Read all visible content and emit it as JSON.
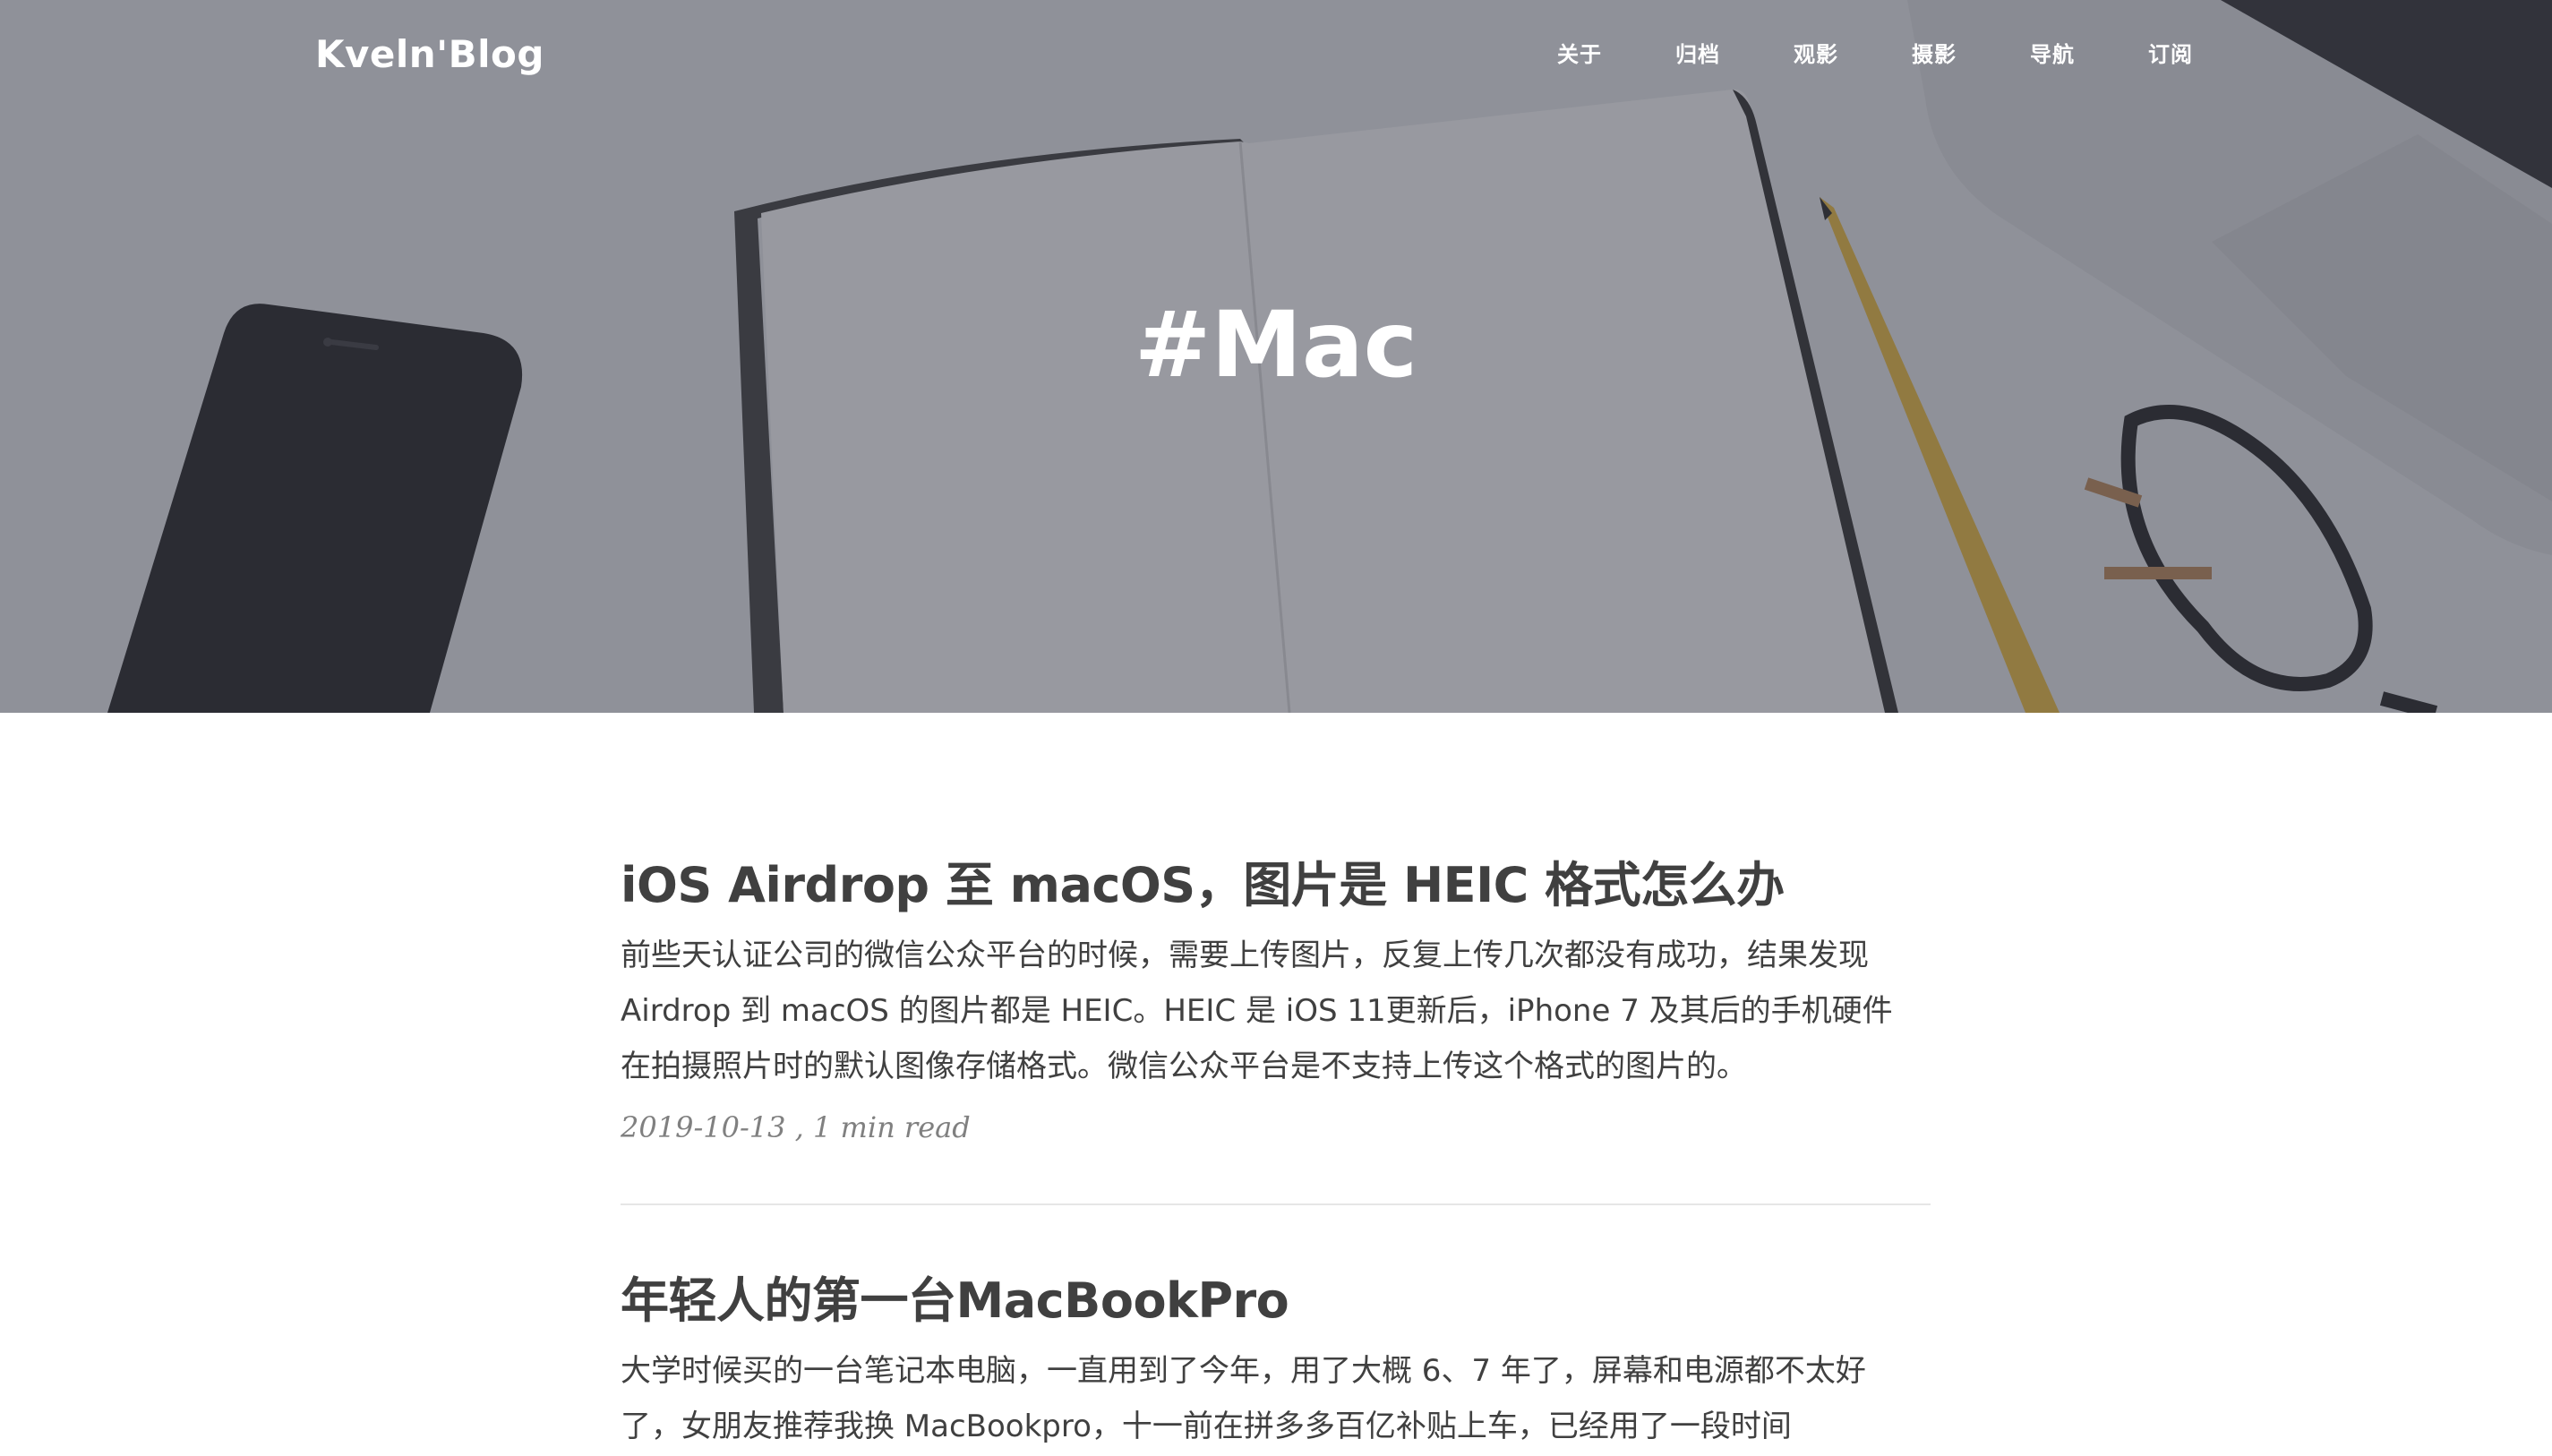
{
  "site": {
    "brand": "Kveln'Blog"
  },
  "nav": {
    "items": [
      {
        "label": "关于"
      },
      {
        "label": "归档"
      },
      {
        "label": "观影"
      },
      {
        "label": "摄影"
      },
      {
        "label": "导航"
      },
      {
        "label": "订阅"
      }
    ]
  },
  "hero": {
    "title": "#Mac"
  },
  "posts": [
    {
      "title": "iOS Airdrop 至 macOS，图片是 HEIC 格式怎么办",
      "excerpt": "前些天认证公司的微信公众平台的时候，需要上传图片，反复上传几次都没有成功，结果发现 Airdrop 到 macOS 的图片都是 HEIC。HEIC 是 iOS 11更新后，iPhone 7 及其后的手机硬件在拍摄照片时的默认图像存储格式。微信公众平台是不支持上传这个格式的图片的。",
      "meta": "2019-10-13 , 1 min read"
    },
    {
      "title": "年轻人的第一台MacBookPro",
      "excerpt": "大学时候买的一台笔记本电脑，一直用到了今年，用了大概 6、7 年了，屏幕和电源都不太好了，女朋友推荐我换 MacBookpro，十一前在拼多多百亿补贴上车，已经用了一段时间"
    }
  ],
  "colors": {
    "text": "#404040",
    "meta": "#808080",
    "divider": "#e6e6e6",
    "hero_overlay": "#3a3c48"
  }
}
